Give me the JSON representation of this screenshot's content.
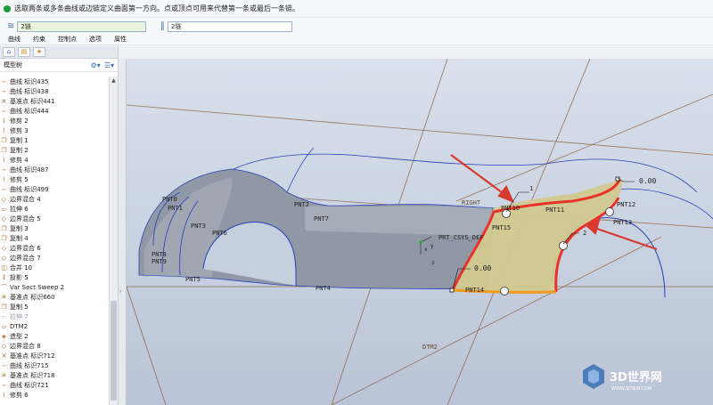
{
  "message": "选取两条或多条曲线或边链定义曲面第一方向。点或顶点可用来代替第一条或最后一条链。",
  "collector": {
    "first_label": "第一方向",
    "first_value": "2链",
    "second_label": "第二方向",
    "second_value": "2链"
  },
  "tabs": [
    "曲线",
    "约束",
    "控制点",
    "选项",
    "属性"
  ],
  "tree": {
    "title": "模型树",
    "items": [
      {
        "icon": "curve-icon",
        "label": "曲线 标识435"
      },
      {
        "icon": "curve-icon",
        "label": "曲线 标识438"
      },
      {
        "icon": "datum-point-icon",
        "label": "基准点 标识441"
      },
      {
        "icon": "curve-icon",
        "label": "曲线 标识444"
      },
      {
        "icon": "trim-icon",
        "label": "修剪 2"
      },
      {
        "icon": "trim-icon",
        "label": "修剪 3"
      },
      {
        "icon": "copy-icon",
        "label": "复制 1"
      },
      {
        "icon": "copy-icon",
        "label": "复制 2"
      },
      {
        "icon": "trim-icon",
        "label": "修剪 4"
      },
      {
        "icon": "curve-icon",
        "label": "曲线 标识487"
      },
      {
        "icon": "trim-icon",
        "label": "修剪 5"
      },
      {
        "icon": "curve-icon",
        "label": "曲线 标识499"
      },
      {
        "icon": "boundary-blend-icon",
        "label": "边界混合 4"
      },
      {
        "icon": "extrude-icon",
        "label": "拉伸 6"
      },
      {
        "icon": "boundary-blend-icon",
        "label": "边界混合 5"
      },
      {
        "icon": "copy-icon",
        "label": "复制 3"
      },
      {
        "icon": "copy-icon",
        "label": "复制 4"
      },
      {
        "icon": "boundary-blend-icon",
        "label": "边界混合 6"
      },
      {
        "icon": "boundary-blend-icon",
        "label": "边界混合 7"
      },
      {
        "icon": "merge-icon",
        "label": "合并 10"
      },
      {
        "icon": "projection-icon",
        "label": "投影 5"
      },
      {
        "icon": "sweep-icon",
        "label": "Var Sect Sweep 2"
      },
      {
        "icon": "datum-point-icon",
        "label": "基准点 标识660"
      },
      {
        "icon": "copy-icon",
        "label": "复制 5"
      },
      {
        "icon": "extrude-icon",
        "label": "拉伸 7",
        "dim": true
      },
      {
        "icon": "datum-plane-icon",
        "label": "DTM2"
      },
      {
        "icon": "shape-icon",
        "label": "造型 2"
      },
      {
        "icon": "boundary-blend-icon",
        "label": "边界混合 8"
      },
      {
        "icon": "datum-point-icon",
        "label": "基准点 标识712"
      },
      {
        "icon": "curve-icon",
        "label": "曲线 标识715"
      },
      {
        "icon": "datum-point-icon",
        "label": "基准点 标识718"
      },
      {
        "icon": "curve-icon",
        "label": "曲线 标识721"
      },
      {
        "icon": "trim-icon",
        "label": "修剪 6"
      }
    ]
  },
  "viewport": {
    "labels": {
      "pnt0": "PNT0",
      "pnt1": "PNT1",
      "pnt2": "PNT2",
      "pnt3": "PNT3",
      "pnt4": "PNT4",
      "pnt5": "PNT5",
      "pnt6": "PNT6",
      "pnt7": "PNT7",
      "pnt8": "PNT8",
      "pnt9": "PNT9",
      "pnt10": "PNT10",
      "pnt11": "PNT11",
      "pnt12": "PNT12",
      "pnt13": "PNT13",
      "pnt14": "PNT14",
      "pnt15": "PNT15",
      "pnt_csys": "PRT_CSYS_DEF",
      "right": "RIGHT",
      "dtm2": "DTM2",
      "dim1": "0.00",
      "dim2": "0.00",
      "idx1": "1",
      "idx2": "2",
      "x": "x",
      "y": "y",
      "z": "z"
    },
    "colors": {
      "chain": "#e8322b",
      "chain_bottom": "#f29a1e",
      "surface_fill": "#d2c98f",
      "datum_line": "#8a6040",
      "curve": "#2b3fb8"
    }
  },
  "watermark": {
    "title": "3D世界网",
    "url": "WWW.3DSJW.COM"
  }
}
